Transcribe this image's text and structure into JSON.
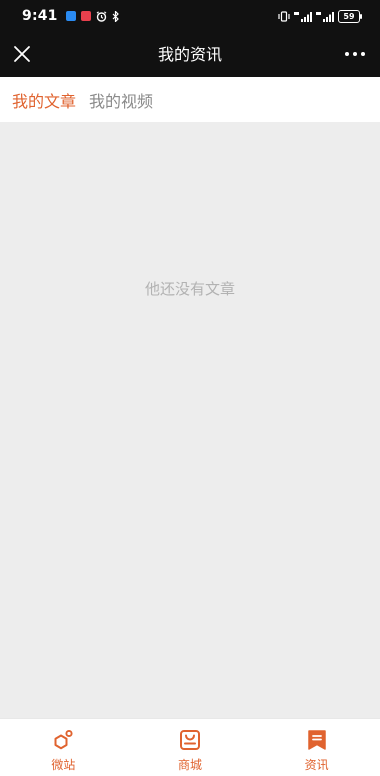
{
  "status_bar": {
    "time": "9:41",
    "battery": "59"
  },
  "header": {
    "title": "我的资讯"
  },
  "tabs": [
    {
      "label": "我的文章",
      "active": true
    },
    {
      "label": "我的视频",
      "active": false
    }
  ],
  "content": {
    "empty_message": "他还没有文章"
  },
  "bottom_nav": [
    {
      "label": "微站",
      "icon": "hexagon-node-icon"
    },
    {
      "label": "商城",
      "icon": "shopping-bag-icon"
    },
    {
      "label": "资讯",
      "icon": "bookmark-news-icon"
    }
  ],
  "colors": {
    "accent": "#e0632f",
    "header_bg": "#111111",
    "page_bg": "#ededed"
  }
}
